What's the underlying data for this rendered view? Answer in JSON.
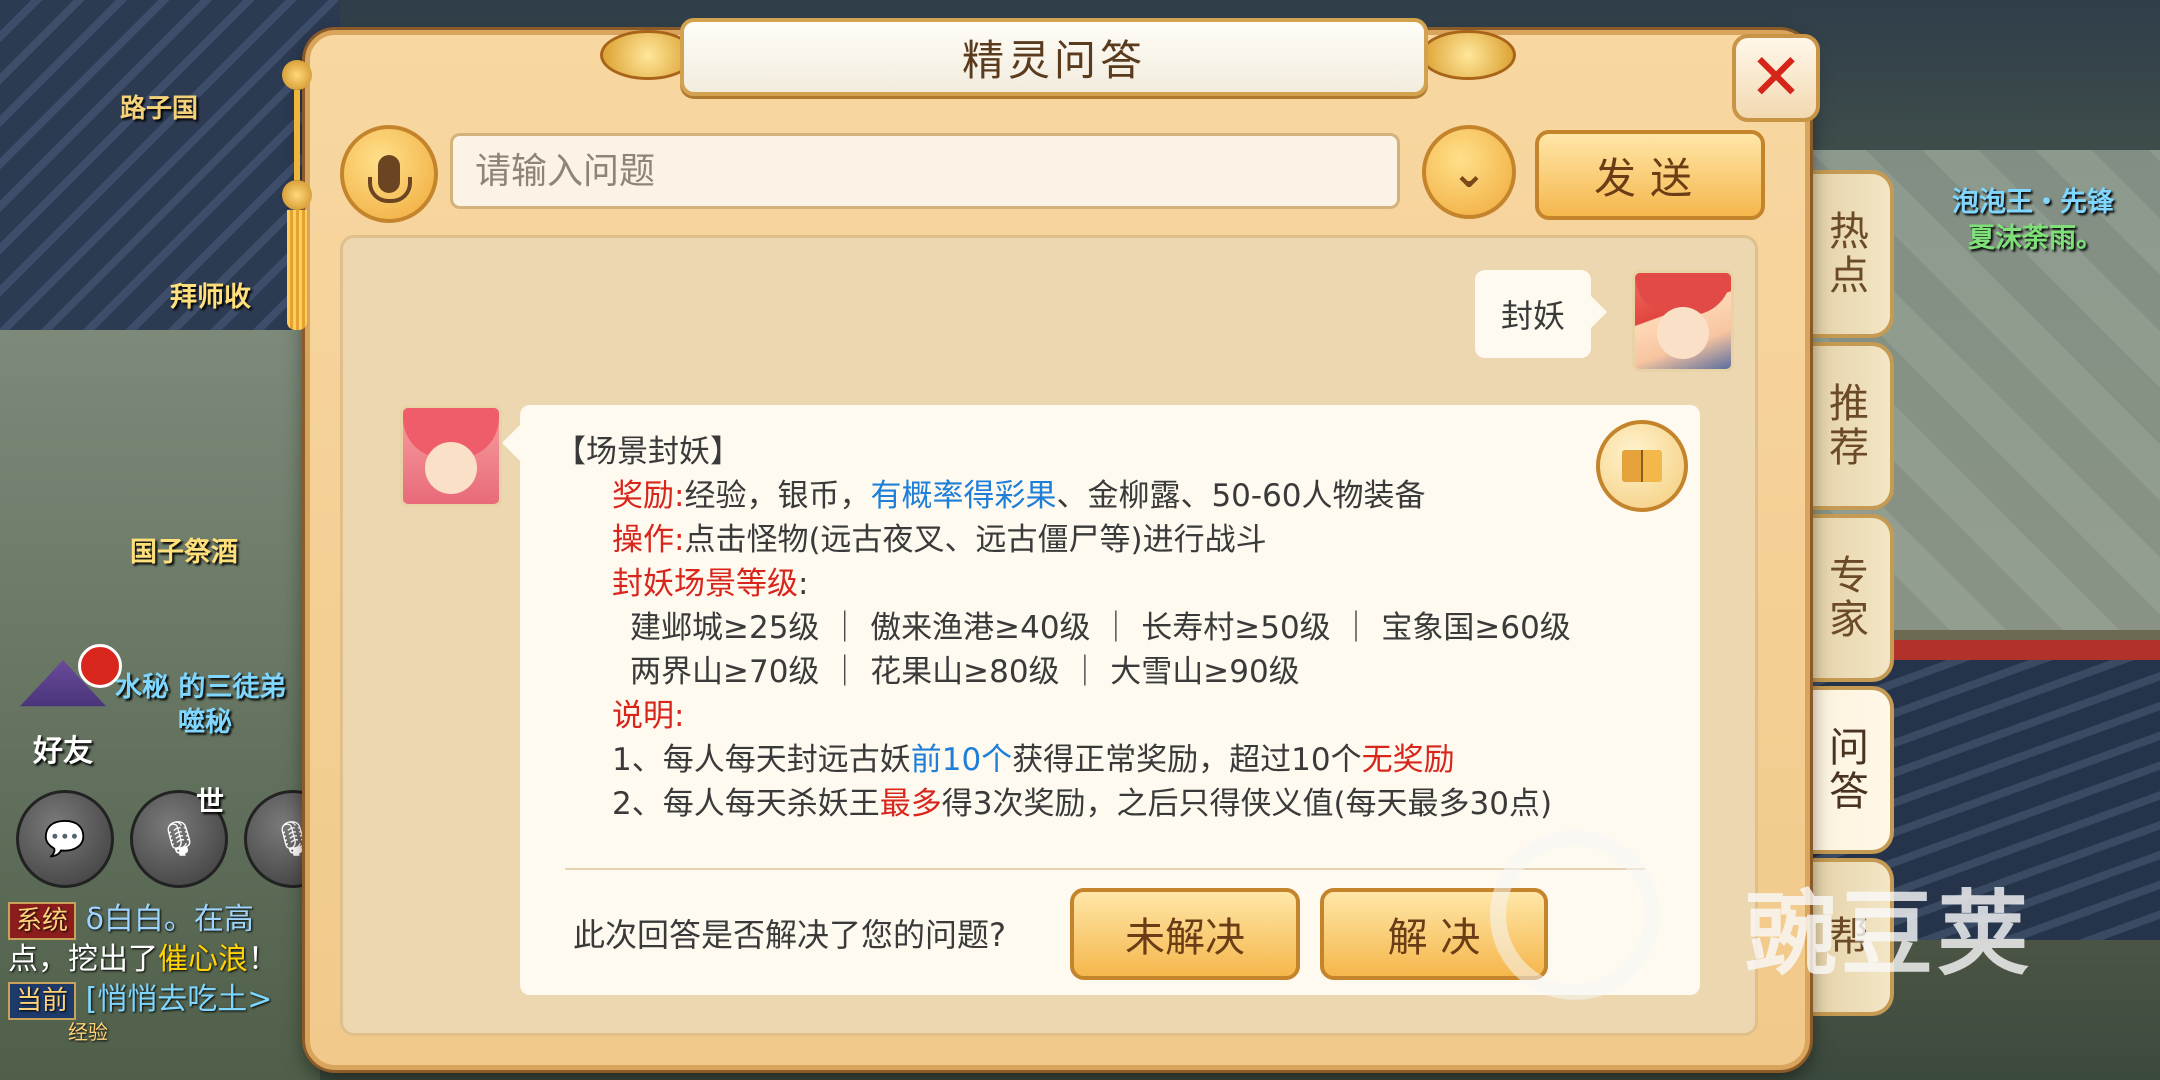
{
  "dialog": {
    "title": "精灵问答",
    "close_label": "✕"
  },
  "input": {
    "placeholder": "请输入问题",
    "send_label": "发送"
  },
  "side_tabs": [
    {
      "label": "热点"
    },
    {
      "label": "推荐"
    },
    {
      "label": "专家"
    },
    {
      "label": "问答"
    },
    {
      "label": "帮"
    }
  ],
  "conversation": {
    "user_message": "封妖",
    "answer": {
      "heading": "【场景封妖】",
      "reward_label": "奖励:",
      "reward_text_1": "经验，银币，",
      "reward_highlight": "有概率得彩果",
      "reward_text_2": "、金柳露、50-60人物装备",
      "operation_label": "操作:",
      "operation_text": "点击怪物(远古夜叉、远古僵尸等)进行战斗",
      "level_label": "封妖场景等级",
      "level_colon": ":",
      "levels_row1": "建邺城≥25级 ｜ 傲来渔港≥40级 ｜ 长寿村≥50级 ｜ 宝象国≥60级",
      "levels_row2": "两界山≥70级  ｜  花果山≥80级  ｜  大雪山≥90级",
      "note_label": "说明:",
      "note1_a": "1、每人每天封远古妖",
      "note1_b": "前10个",
      "note1_c": "获得正常奖励，超过10个",
      "note1_d": "无奖励",
      "note2_a": "2、每人每天杀妖王",
      "note2_b": "最多",
      "note2_c": "得3次奖励，之后只得侠义值(每天最多30点)"
    },
    "feedback": {
      "question": "此次回答是否解决了您的问题?",
      "unresolved_label": "未解决",
      "resolved_label": "解 决"
    }
  },
  "hud": {
    "friends_label": "好友",
    "world_label": "世",
    "npc_top_right_1": "泡泡王・先锋",
    "npc_top_right_2": "夏沫荼雨。",
    "npc_left_1": "拜师收",
    "npc_left_2": "国子祭酒",
    "npc_left_3": "水秘 的三徒弟",
    "npc_left_4": "噬秘",
    "sign_text": "路子国",
    "chat_sys_tag": "系统",
    "chat_line1": "δ白白。在高",
    "chat_line2a": "点，挖出了",
    "chat_line2b": "催心浪",
    "chat_line2c": "！",
    "chat_cur_tag": "当前",
    "chat_line3": "[悄悄去吃土>",
    "chat_line4": "经验"
  },
  "watermark": {
    "text": "豌豆荚"
  },
  "colors": {
    "accent_red": "#d8261d",
    "accent_blue": "#1f7fd8",
    "button_gold": "#f5b74c",
    "panel_bg": "#f1c98a"
  }
}
